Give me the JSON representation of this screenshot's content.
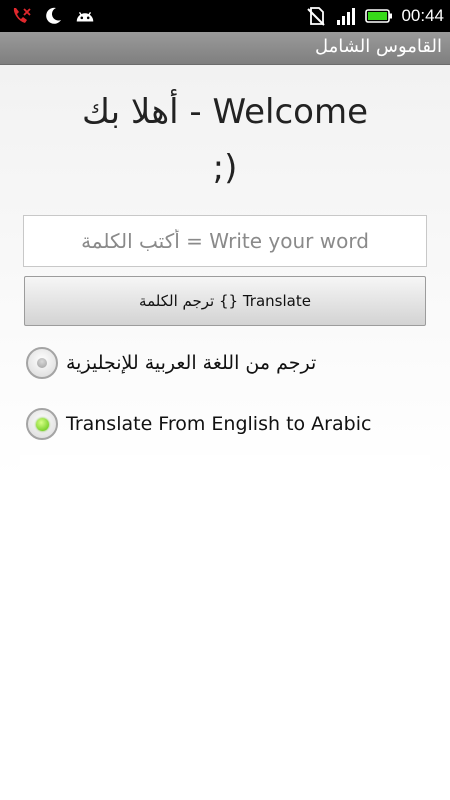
{
  "status_bar": {
    "time": "00:44",
    "icons": [
      "missed-call-icon",
      "moon-icon",
      "android-icon",
      "no-sim-icon",
      "signal-icon",
      "battery-icon"
    ],
    "colors": {
      "background": "#000000",
      "battery": "#37d91a",
      "missed_call": "#e0282d"
    }
  },
  "title_bar": {
    "title": "القاموس الشامل"
  },
  "welcome": {
    "line1": "أهلا بك - Welcome",
    "line2": ";)"
  },
  "search": {
    "placeholder": "أكتب الكلمة = Write your word",
    "value": ""
  },
  "translate_button": {
    "label": "ترجم الكلمة {} Translate"
  },
  "options": [
    {
      "label": "ترجم من اللغة العربية للإنجليزية",
      "selected": false
    },
    {
      "label": "Translate From English to Arabic",
      "selected": true
    }
  ]
}
